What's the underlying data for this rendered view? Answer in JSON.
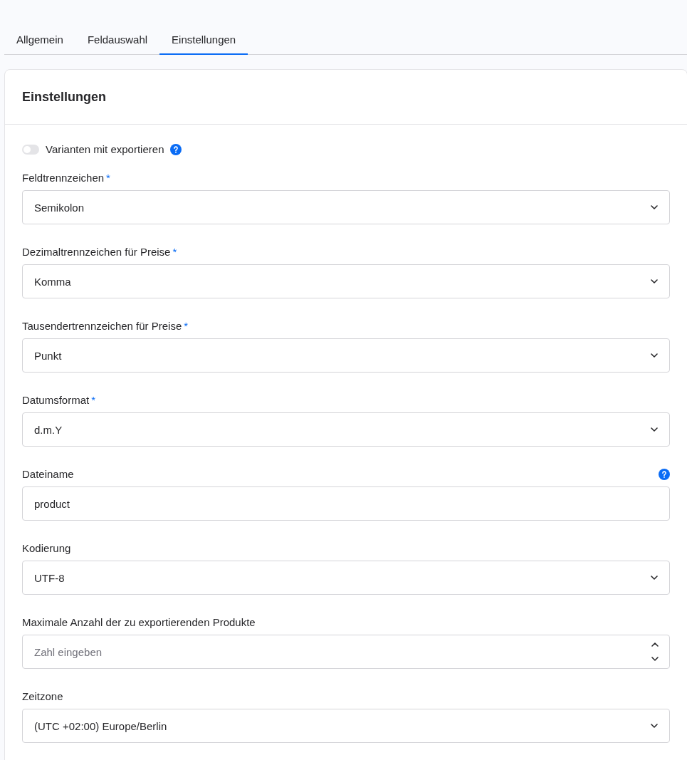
{
  "tabs": [
    {
      "label": "Allgemein",
      "selected": false
    },
    {
      "label": "Feldauswahl",
      "selected": false
    },
    {
      "label": "Einstellungen",
      "selected": true
    }
  ],
  "card": {
    "title": "Einstellungen",
    "toggle": {
      "label": "Varianten mit exportieren",
      "on": false,
      "help": true
    },
    "fields": [
      {
        "kind": "select",
        "label": "Feldtrennzeichen",
        "required_mark": "*",
        "value": "Semikolon"
      },
      {
        "kind": "select",
        "label": "Dezimaltrennzeichen für Preise",
        "required_mark": "*",
        "value": "Komma"
      },
      {
        "kind": "select",
        "label": "Tausendertrennzeichen für Preise",
        "required_mark": "*",
        "value": "Punkt"
      },
      {
        "kind": "select",
        "label": "Datumsformat",
        "required_mark": "*",
        "value": "d.m.Y"
      },
      {
        "kind": "text",
        "label": "Dateiname",
        "help": true,
        "value": "product"
      },
      {
        "kind": "select",
        "label": "Kodierung",
        "value": "UTF-8"
      },
      {
        "kind": "number",
        "label": "Maximale Anzahl der zu exportierenden Produkte",
        "placeholder": "Zahl eingeben"
      },
      {
        "kind": "select",
        "label": "Zeitzone",
        "value": "(UTC +02:00) Europe/Berlin"
      }
    ]
  }
}
